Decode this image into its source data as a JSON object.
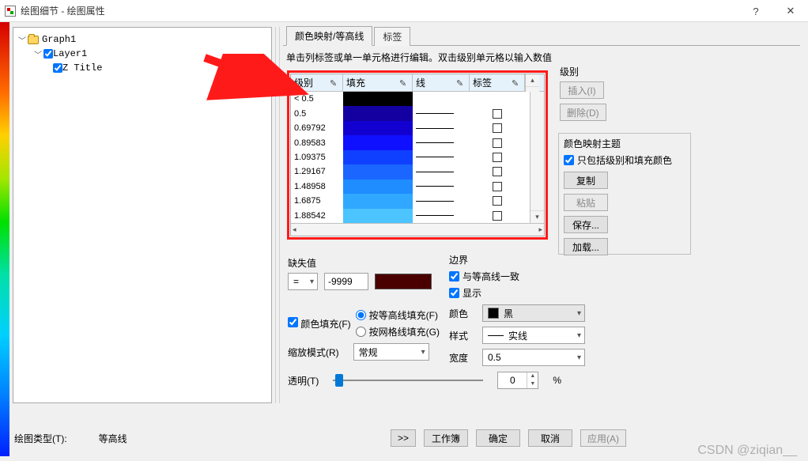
{
  "window": {
    "title": "绘图细节 - 绘图属性",
    "help": "?",
    "close": "✕"
  },
  "tree": {
    "root": "Graph1",
    "layer": "Layer1",
    "item": "Z Title"
  },
  "tabs": {
    "color_contour": "颜色映射/等高线",
    "label": "标签"
  },
  "hint": "单击列标签或单一单元格进行编辑。双击级别单元格以输入数值",
  "table": {
    "headers": {
      "level": "级别",
      "fill": "填充",
      "line": "线",
      "label": "标签"
    },
    "rows": [
      {
        "level": "< 0.5",
        "fill": "#000000"
      },
      {
        "level": "0.5",
        "fill": "#1400A0"
      },
      {
        "level": "0.69792",
        "fill": "#1200D0"
      },
      {
        "level": "0.89583",
        "fill": "#0F10FF"
      },
      {
        "level": "1.09375",
        "fill": "#1040FF"
      },
      {
        "level": "1.29167",
        "fill": "#1A66FF"
      },
      {
        "level": "1.48958",
        "fill": "#1F8CFF"
      },
      {
        "level": "1.6875",
        "fill": "#30A8FF"
      },
      {
        "level": "1.88542",
        "fill": "#4CC4FF"
      }
    ]
  },
  "level_group": {
    "title": "级别",
    "insert": "插入(I)",
    "delete": "删除(D)"
  },
  "theme": {
    "title": "颜色映射主题",
    "only_levels_fill": "只包括级别和填充颜色",
    "copy": "复制",
    "paste": "粘贴",
    "save": "保存...",
    "load": "加载..."
  },
  "missing": {
    "title": "缺失值",
    "op": "=",
    "value": "-9999",
    "swatch": "#4b0000"
  },
  "fill": {
    "enable": "颜色填充(F)",
    "by_contour": "按等高线填充(F)",
    "by_grid": "按网格线填充(G)"
  },
  "scale": {
    "label": "缩放模式(R)",
    "value": "常规"
  },
  "transparency": {
    "label": "透明(T)",
    "value": "0",
    "suffix": "%"
  },
  "boundary": {
    "title": "边界",
    "same_as_contour": "与等高线一致",
    "show": "显示",
    "color_label": "颜色",
    "color_value": "黑",
    "style_label": "样式",
    "style_value": "实线",
    "width_label": "宽度",
    "width_value": "0.5"
  },
  "bottom": {
    "plot_type_label": "绘图类型(T):",
    "plot_type_value": "等高线",
    "expand": ">>",
    "workbook": "工作簿",
    "ok": "确定",
    "cancel": "取消",
    "apply": "应用(A)"
  },
  "watermark": "CSDN @ziqian__"
}
